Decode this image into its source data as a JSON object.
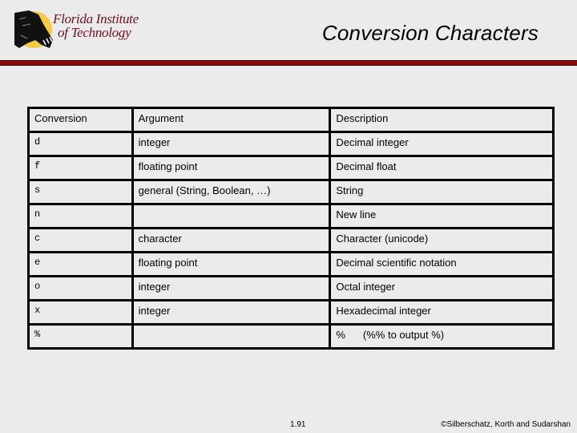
{
  "header": {
    "logo_line1": "Florida Institute",
    "logo_line2": "of Technology",
    "title": "Conversion Characters"
  },
  "colors": {
    "background": "#ebebeb",
    "rule": "#8a0a0a",
    "logo_text": "#6e0f1f",
    "logo_sun": "#f7c948"
  },
  "table": {
    "headers": [
      "Conversion",
      "Argument",
      "Description"
    ],
    "rows": [
      {
        "conversion": "d",
        "argument": "integer",
        "description": "Decimal integer"
      },
      {
        "conversion": "f",
        "argument": "floating point",
        "description": "Decimal float"
      },
      {
        "conversion": "s",
        "argument": "general (String, Boolean, …)",
        "description": "String"
      },
      {
        "conversion": "n",
        "argument": "",
        "description": "New line"
      },
      {
        "conversion": "c",
        "argument": "character",
        "description": "Character (unicode)"
      },
      {
        "conversion": "e",
        "argument": "floating point",
        "description": "Decimal scientific notation"
      },
      {
        "conversion": "o",
        "argument": "integer",
        "description": "Octal integer"
      },
      {
        "conversion": "x",
        "argument": "integer",
        "description": "Hexadecimal integer"
      },
      {
        "conversion": "%",
        "argument": "",
        "description_symbol": "%",
        "description": "(%% to output %)"
      }
    ]
  },
  "footer": {
    "page_number": "1.91",
    "copyright": "©Silberschatz, Korth and Sudarshan"
  }
}
